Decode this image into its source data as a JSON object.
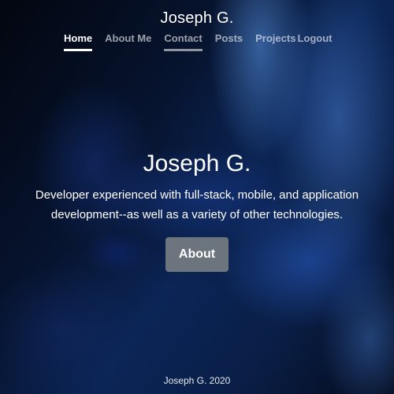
{
  "header": {
    "brand": "Joseph G.",
    "nav": [
      {
        "label": "Home",
        "active": true
      },
      {
        "label": "About Me"
      },
      {
        "label": "Contact"
      },
      {
        "label": "Posts"
      },
      {
        "label": "Projects"
      },
      {
        "label": "Logout"
      }
    ]
  },
  "hero": {
    "title": "Joseph G.",
    "lead_line1": "Developer experienced with full-stack, mobile, and application",
    "lead_line2": "development--as well as a variety of other technologies.",
    "button_label": "About"
  },
  "footer": {
    "text": "Joseph G. 2020"
  },
  "colors": {
    "button_bg": "#6c757d",
    "background": "#050d1c"
  }
}
